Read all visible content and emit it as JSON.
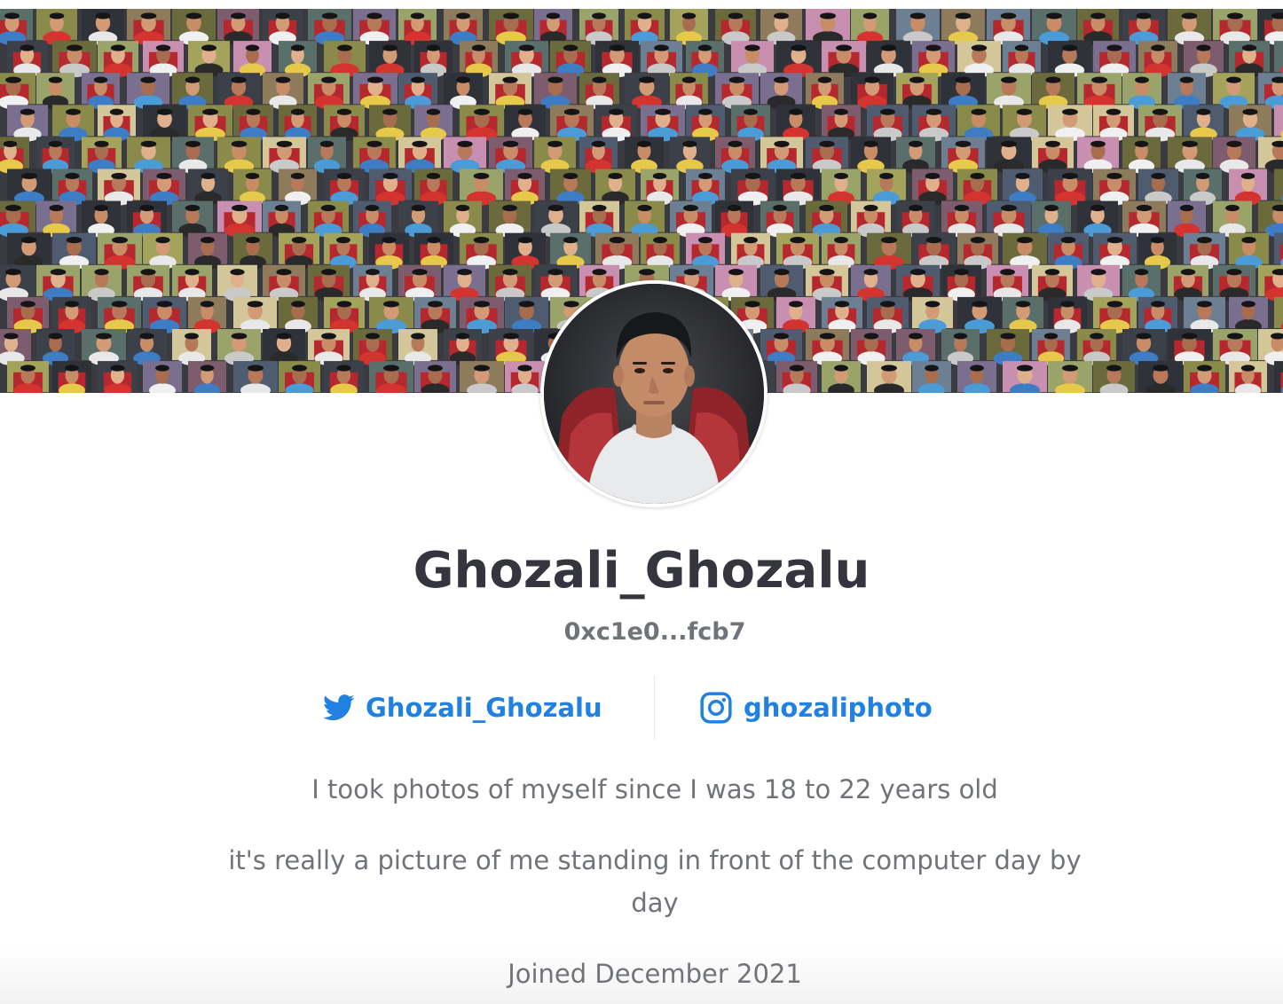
{
  "profile": {
    "username": "Ghozali_Ghozalu",
    "wallet_address": "0xc1e0...fcb7",
    "twitter": {
      "handle": "Ghozali_Ghozalu",
      "icon": "twitter-bird-icon"
    },
    "instagram": {
      "handle": "ghozaliphoto",
      "icon": "instagram-icon"
    },
    "bio": [
      "I took photos of myself since I was 18 to 22 years old",
      "it's really a picture of me standing in front of the computer day by day"
    ],
    "joined": "Joined December 2021"
  },
  "banner": {
    "description_icon": "selfie-mosaic-banner"
  },
  "colors": {
    "accent_link": "#2081e2",
    "username_text": "#35363d",
    "secondary_text": "#707479",
    "divider": "#e5e8eb"
  }
}
